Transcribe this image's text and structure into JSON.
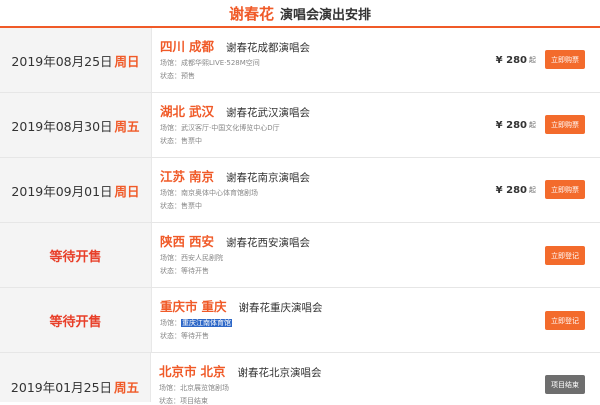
{
  "header": {
    "artist": "谢春花",
    "subtitle": "演唱会演出安排"
  },
  "rows": [
    {
      "date": "2019年08月25日",
      "weekday": "周日",
      "province": "四川",
      "city": "成都",
      "concert": "谢春花成都演唱会",
      "venue": "场馆：成都华熙LIVE·528M空间",
      "status": "状态：预售",
      "price": "¥ 280",
      "price_unit": "起",
      "button": "立即购票"
    },
    {
      "date": "2019年08月30日",
      "weekday": "周五",
      "province": "湖北",
      "city": "武汉",
      "concert": "谢春花武汉演唱会",
      "venue": "场馆：武汉客厅·中国文化博览中心D厅",
      "status": "状态：售票中",
      "price": "¥ 280",
      "price_unit": "起",
      "button": "立即购票"
    },
    {
      "date": "2019年09月01日",
      "weekday": "周日",
      "province": "江苏",
      "city": "南京",
      "concert": "谢春花南京演唱会",
      "venue": "场馆：南京奥体中心体育馆剧场",
      "status": "状态：售票中",
      "price": "¥ 280",
      "price_unit": "起",
      "button": "立即购票"
    },
    {
      "presale": "等待开售",
      "province": "陕西",
      "city": "西安",
      "concert": "谢春花西安演唱会",
      "venue": "场馆：西安人民剧院",
      "status": "状态：等待开售",
      "button": "立即登记"
    },
    {
      "presale": "等待开售",
      "province": "重庆市",
      "city": "重庆",
      "concert": "谢春花重庆演唱会",
      "venue_label": "场馆：",
      "venue_value": "重庆江南体育馆",
      "status": "状态：等待开售",
      "button": "立即登记"
    },
    {
      "date": "2019年01月25日",
      "weekday": "周五",
      "province": "北京市",
      "city": "北京",
      "concert": "谢春花北京演唱会",
      "venue": "场馆：北京展览馆剧场",
      "status": "状态：项目结束",
      "button": "项目结束"
    }
  ]
}
